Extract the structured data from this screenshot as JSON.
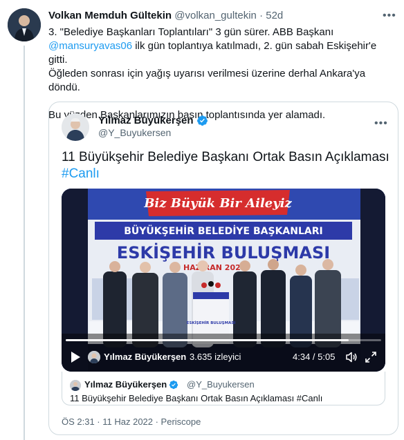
{
  "tweet": {
    "author_name": "Volkan Memduh Gültekin",
    "author_handle": "@volkan_gultekin",
    "separator": "·",
    "time": "52d",
    "more_icon": "more-horizontal-icon",
    "text_line1": "3. \"Belediye Başkanları Toplantıları\" 3 gün sürer. ABB Başkanı",
    "mention": "@mansuryavas06",
    "text_line2_rest": " ilk gün toplantıya katılmadı, 2. gün sabah Eskişehir'e gitti.",
    "text_line3": "Öğleden sonrası için yağış uyarısı verilmesi üzerine derhal Ankara'ya döndü.",
    "text_para2": "Bu yüzden Başkanlarımızın basın toplantısında yer alamadı."
  },
  "quote": {
    "author_name": "Yılmaz Büyükerşen",
    "author_handle": "@Y_Buyukersen",
    "verified_icon": "verified-badge-icon",
    "text": "11 Büyükşehir Belediye Başkanı Ortak Basın Açıklaması",
    "hashtag": "#Canlı",
    "video": {
      "banner_top": "Biz Büyük Bir Aileyiz",
      "banner_mid": "BÜYÜKŞEHİR BELEDİYE BAŞKANLARI",
      "banner_main": "ESKİŞEHİR BULUŞMASI",
      "banner_date": "HAZİRAN 2022",
      "podium_text": "ESKİŞEHİR BULUŞMASI",
      "broadcaster": "Yılmaz Büyükerşen",
      "separator": "·",
      "views": "3.635 izleyici",
      "time": "4:34 / 5:05",
      "progress": 0.898,
      "play_icon": "play-icon",
      "volume_icon": "volume-icon",
      "fullscreen_icon": "fullscreen-icon"
    },
    "inner": {
      "author_name": "Yılmaz Büyükerşen",
      "author_handle": "@Y_Buyukersen",
      "text": "11 Büyükşehir Belediye Başkanı Ortak Basın Açıklaması #Canlı"
    },
    "meta": "ÖS 2:31 · 11 Haz 2022 · Periscope"
  },
  "colors": {
    "accent": "#1d9bf0",
    "text": "#0f1419",
    "muted": "#536471",
    "border": "#cfd9de"
  }
}
